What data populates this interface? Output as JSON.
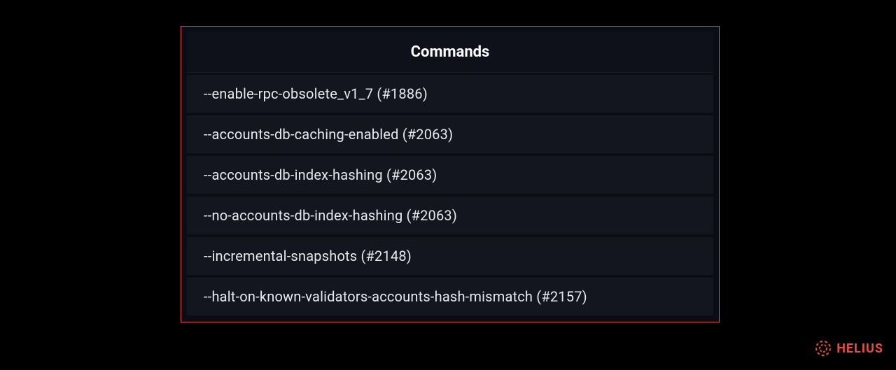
{
  "table": {
    "header": "Commands",
    "rows": [
      "--enable-rpc-obsolete_v1_7 (#1886)",
      "--accounts-db-caching-enabled (#2063)",
      "--accounts-db-index-hashing (#2063)",
      "--no-accounts-db-index-hashing (#2063)",
      "--incremental-snapshots (#2148)",
      "--halt-on-known-validators-accounts-hash-mismatch (#2157)"
    ]
  },
  "branding": {
    "name": "HELIUS",
    "accent_color": "#e84c3d"
  }
}
